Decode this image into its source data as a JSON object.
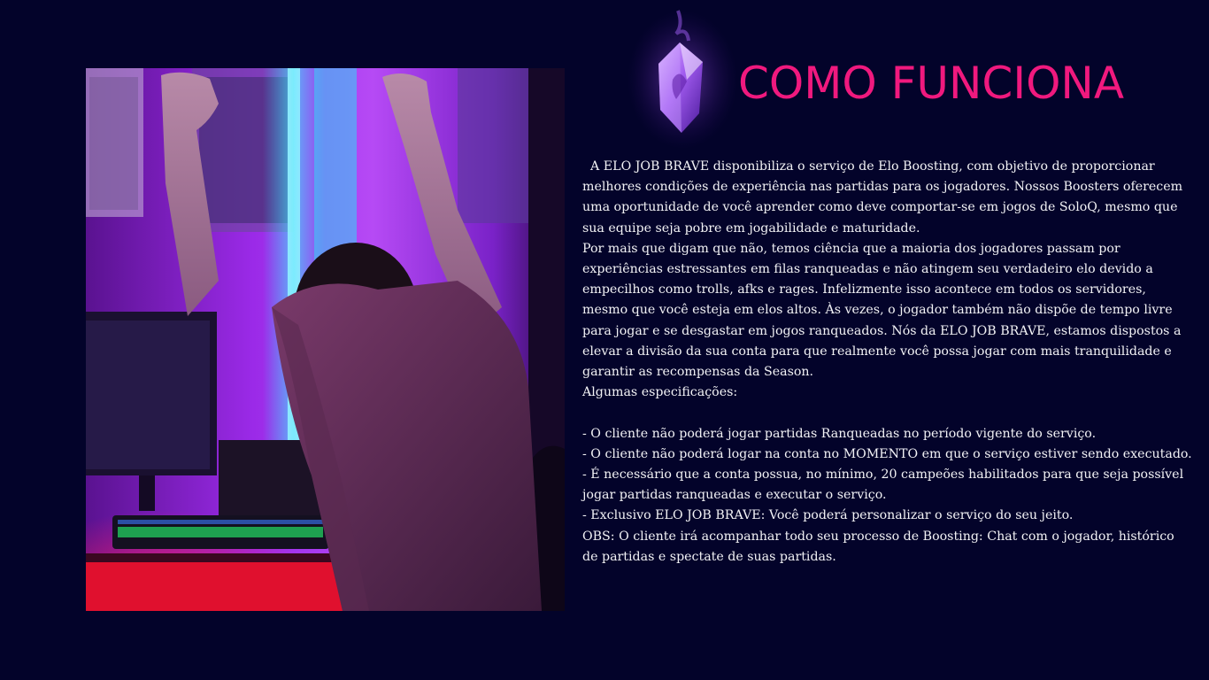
{
  "header": {
    "title": "COMO FUNCIONA"
  },
  "icons": {
    "crystal": "purple-crystal-icon"
  },
  "colors": {
    "background": "#03032a",
    "title": "#f0197e",
    "text": "#f2f2f5"
  },
  "content": {
    "intro": "  A ELO JOB BRAVE disponibiliza o serviço de Elo Boosting, com objetivo de proporcionar melhores condições de experiência nas partidas para os jogadores. Nossos Boosters oferecem uma oportunidade de você aprender como deve comportar-se em jogos de SoloQ, mesmo que sua equipe seja pobre em jogabilidade e maturidade.",
    "paragraph2": "Por mais que digam que não, temos ciência que a maioria dos jogadores passam por experiências estressantes em filas ranqueadas e não atingem seu verdadeiro elo devido a empecilhos como trolls, afks e rages. Infelizmente isso acontece em todos os servidores, mesmo que você esteja em elos altos. Às vezes, o jogador também não dispõe de tempo livre para jogar e se desgastar em jogos ranqueados. Nós da ELO JOB BRAVE, estamos dispostos a elevar a divisão da sua conta para que realmente você possa jogar com mais tranquilidade e garantir as recompensas da Season.",
    "specs_heading": "Algumas especificações:",
    "specs": [
      "- O cliente não poderá jogar partidas Ranqueadas no período vigente do serviço.",
      "- O cliente não poderá logar na conta no MOMENTO em que o serviço estiver sendo executado.",
      "- É necessário que a conta possua, no mínimo, 20 campeões habilitados para que seja possível jogar partidas ranqueadas e executar o serviço.",
      "- Exclusivo ELO JOB BRAVE: Você poderá personalizar o serviço do seu jeito."
    ],
    "obs": "OBS: O cliente irá acompanhar todo seu processo de Boosting: Chat com o jogador, histórico de partidas e spectate de suas partidas."
  }
}
